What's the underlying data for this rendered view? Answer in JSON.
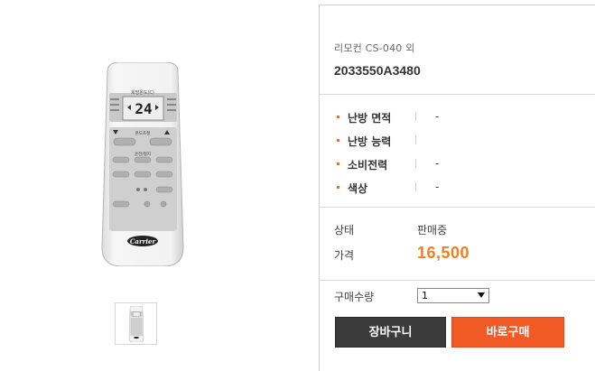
{
  "product": {
    "subtitle": "리모컨 CS-040 외",
    "code": "2033550A3480"
  },
  "specs": [
    {
      "label": "난방 면적",
      "value": "-"
    },
    {
      "label": "난방 능력",
      "value": ""
    },
    {
      "label": "소비전력",
      "value": "-"
    },
    {
      "label": "색상",
      "value": "-"
    }
  ],
  "pricing": {
    "status_label": "상태",
    "status_value": "판매중",
    "price_label": "가격",
    "price_value": "16,500"
  },
  "quantity": {
    "label": "구매수량",
    "selected": "1"
  },
  "buttons": {
    "cart": "장바구니",
    "buy": "바로구매"
  },
  "remote": {
    "display": "24",
    "brand": "Carrier",
    "temp_label": "희망온도(C)",
    "temp_adjust": "온도조절",
    "power": "운전/정지"
  },
  "colors": {
    "accent_orange": "#f07f1f",
    "buy_button": "#f15a24",
    "cart_button": "#3b3b3b"
  }
}
